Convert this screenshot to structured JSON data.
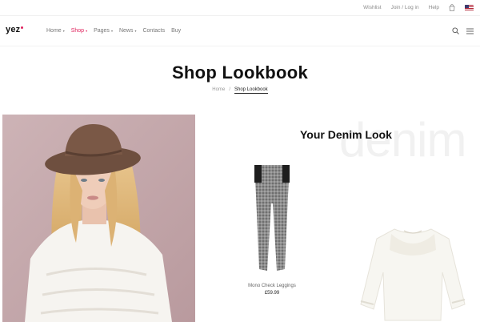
{
  "topbar": {
    "wishlist": "Wishlist",
    "join_login": "Join / Log in",
    "help": "Help"
  },
  "header": {
    "logo": "yez",
    "nav": [
      {
        "label": "Home",
        "has_caret": true,
        "active": false
      },
      {
        "label": "Shop",
        "has_caret": true,
        "active": true
      },
      {
        "label": "Pages",
        "has_caret": true,
        "active": false
      },
      {
        "label": "News",
        "has_caret": true,
        "active": false
      },
      {
        "label": "Contacts",
        "has_caret": false,
        "active": false
      },
      {
        "label": "Buy",
        "has_caret": false,
        "active": false
      }
    ],
    "caret": "▾"
  },
  "page": {
    "title": "Shop Lookbook",
    "breadcrumb": {
      "home": "Home",
      "sep": "/",
      "current": "Shop Lookbook"
    }
  },
  "lookbook": {
    "background_word": "denim",
    "title": "Your Denim Look",
    "products": [
      {
        "name": "Mono Check Leggings",
        "price": "£59.99"
      }
    ]
  },
  "colors": {
    "accent": "#e0245e",
    "photo_bg": "#c7aeb1"
  },
  "icons": [
    "cart-icon",
    "flag-us-icon",
    "search-icon",
    "menu-icon"
  ]
}
